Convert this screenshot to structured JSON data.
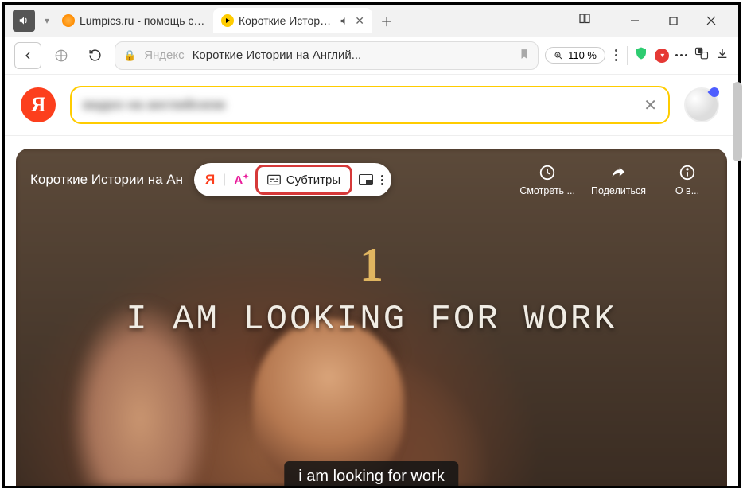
{
  "tabs": [
    {
      "label": "Lumpics.ru - помощь с ком"
    },
    {
      "label": "Короткие Истории н"
    }
  ],
  "urlbar": {
    "yandex_label": "Яндекс",
    "page_title": "Короткие Истории на Англий...",
    "zoom": "110 %"
  },
  "search": {
    "query": "видео на английском"
  },
  "video": {
    "title": "Короткие Истории на Ан",
    "toolbar": {
      "ya": "Я",
      "aa": "A",
      "subtitles_label": "Субтитры"
    },
    "actions": {
      "watch": "Смотреть ...",
      "share": "Поделиться",
      "about": "О в..."
    },
    "number": "1",
    "overlay_text": "I AM LOOKING FOR WORK",
    "caption": "i am looking for work"
  }
}
